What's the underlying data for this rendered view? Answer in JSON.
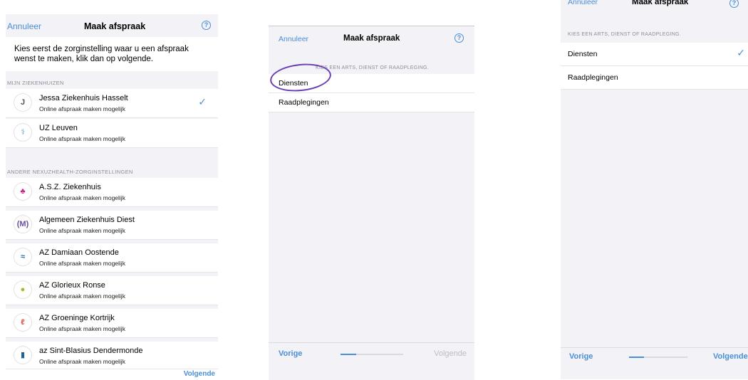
{
  "panel1": {
    "nav": {
      "cancel": "Annuleer",
      "title": "Maak afspraak",
      "help_icon": "question-circle-icon"
    },
    "intro": "Kies eerst de zorginstelling waar u een afspraak wenst te maken, klik dan op volgende.",
    "section_mine": "MIJN ZIEKENHUIZEN",
    "mine": [
      {
        "name": "Jessa Ziekenhuis Hasselt",
        "sub": "Online afspraak maken mogelijk",
        "logo": "J",
        "selected": true
      },
      {
        "name": "UZ Leuven",
        "sub": "Online afspraak maken mogelijk",
        "logo": "⚕",
        "selected": false
      }
    ],
    "section_other": "ANDERE NEXUZHEALTH-ZORGINSTELLINGEN",
    "other": [
      {
        "name": "A.S.Z. Ziekenhuis",
        "sub": "Online afspraak maken mogelijk",
        "logo": "♣"
      },
      {
        "name": "Algemeen Ziekenhuis Diest",
        "sub": "Online afspraak maken mogelijk",
        "logo": "(M)"
      },
      {
        "name": "AZ Damiaan Oostende",
        "sub": "Online afspraak maken mogelijk",
        "logo": "≈"
      },
      {
        "name": "AZ Glorieux Ronse",
        "sub": "Online afspraak maken mogelijk",
        "logo": "●"
      },
      {
        "name": "AZ Groeninge Kortrijk",
        "sub": "Online afspraak maken mogelijk",
        "logo": "ℓ"
      },
      {
        "name": "az Sint-Blasius Dendermonde",
        "sub": "Online afspraak maken mogelijk",
        "logo": "▮"
      }
    ],
    "footer_next": "Volgende"
  },
  "panel2": {
    "nav": {
      "cancel": "Annuleer",
      "title": "Maak afspraak",
      "help_icon": "question-circle-icon"
    },
    "section": "KIES EEN ARTS, DIENST OF RAADPLEGING.",
    "options": [
      "Diensten",
      "Raadplegingen"
    ],
    "footer": {
      "prev": "Vorige",
      "next": "Volgende"
    },
    "progress": 0.25
  },
  "panel3": {
    "nav": {
      "cancel": "Annuleer",
      "title": "Maak afspraak",
      "help_icon": "question-circle-icon"
    },
    "section": "KIES EEN ARTS, DIENST OF RAADPLEGING.",
    "options": [
      "Diensten",
      "Raadplegingen"
    ],
    "selected": "Diensten",
    "footer": {
      "prev": "Vorige",
      "next": "Volgende"
    },
    "progress": 0.25
  },
  "colors": {
    "accent": "#4a8fd6",
    "annotation": "#6a3fb5",
    "background": "#f2f2f7"
  }
}
